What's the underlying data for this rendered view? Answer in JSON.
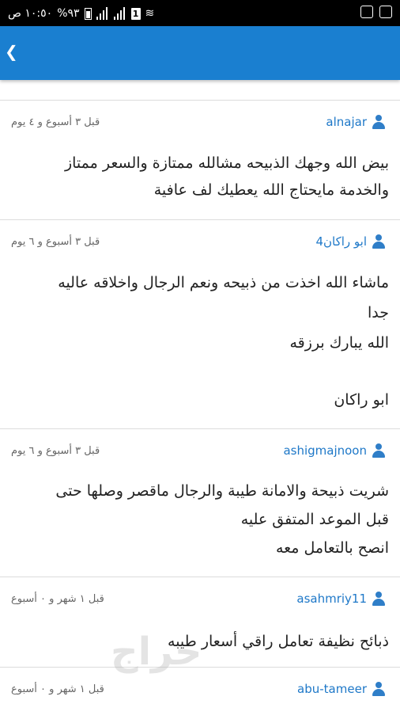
{
  "status_bar": {
    "time": "١٠:٥٠ ص",
    "battery": "%٩٣",
    "sim_badge": "1"
  },
  "app_bar": {
    "back_icon": "chevron-left-icon"
  },
  "comments": [
    {
      "username": "alnajar",
      "time": "قبل ٣ أسبوع و ٤ يوم",
      "lines": [
        "بيض الله وجهك الذبيحه مشالله ممتازة والسعر ممتاز",
        "والخدمة مايحتاج الله يعطيك لف عافية"
      ]
    },
    {
      "username": "ابو راكان4",
      "time": "قبل ٣ أسبوع و ٦ يوم",
      "lines": [
        "ماشاء الله اخذت من ذبيحه ونعم الرجال واخلاقه عاليه",
        "جدا",
        "الله يبارك برزقه",
        "",
        "ابو راكان"
      ]
    },
    {
      "username": "ashigmajnoon",
      "time": "قبل ٣ أسبوع و ٦ يوم",
      "lines": [
        "شريت ذبيحة والامانة طيبة والرجال ماقصر وصلها حتى",
        "قبل الموعد المتفق عليه",
        "انصح بالتعامل معه"
      ]
    },
    {
      "username": "asahmriy11",
      "time": "قبل ١ شهر و ٠ أسبوع",
      "lines": [
        "ذبائح نظيفة تعامل راقي أسعار طيبه"
      ]
    },
    {
      "username": "abu-tameer",
      "time": "قبل ١ شهر و ٠ أسبوع",
      "lines": []
    }
  ],
  "watermark": "حراج"
}
